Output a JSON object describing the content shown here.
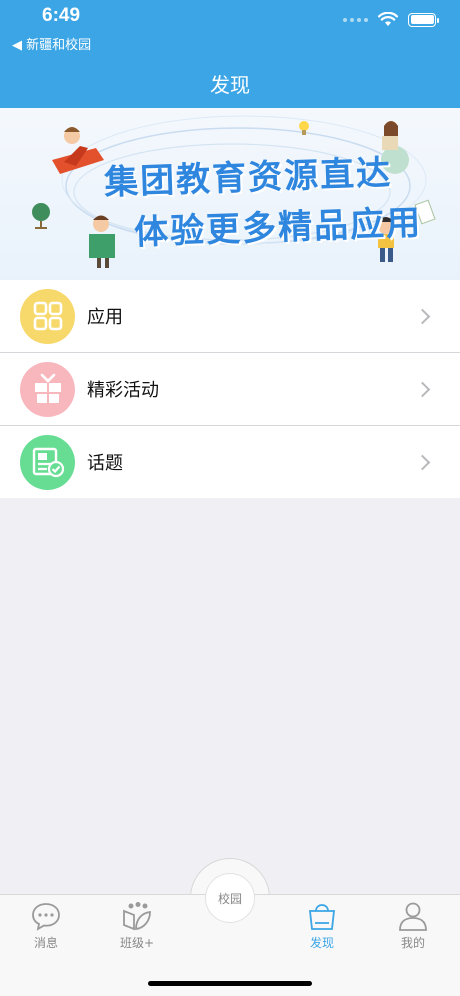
{
  "status_bar": {
    "time": "6:49",
    "back_app": "◀ 新疆和校园"
  },
  "nav": {
    "title": "发现"
  },
  "banner": {
    "line1": "集团教育资源直达",
    "line2": "体验更多精品应用"
  },
  "menu": {
    "items": [
      {
        "label": "应用",
        "icon": "apps-grid-icon",
        "color": "#f7d86a"
      },
      {
        "label": "精彩活动",
        "icon": "gift-icon",
        "color": "#f7b7bd"
      },
      {
        "label": "话题",
        "icon": "news-check-icon",
        "color": "#67dd93"
      }
    ]
  },
  "tabbar": {
    "tabs": [
      {
        "label": "消息",
        "icon": "chat-bubble-icon"
      },
      {
        "label": "班级+",
        "icon": "class-leaf-icon"
      },
      {
        "label": "校园",
        "icon": "campus-circle-icon"
      },
      {
        "label": "发现",
        "icon": "shopping-bag-icon",
        "active": true
      },
      {
        "label": "我的",
        "icon": "person-icon"
      }
    ]
  },
  "colors": {
    "accent": "#3ba5e6",
    "background": "#efeff4"
  }
}
